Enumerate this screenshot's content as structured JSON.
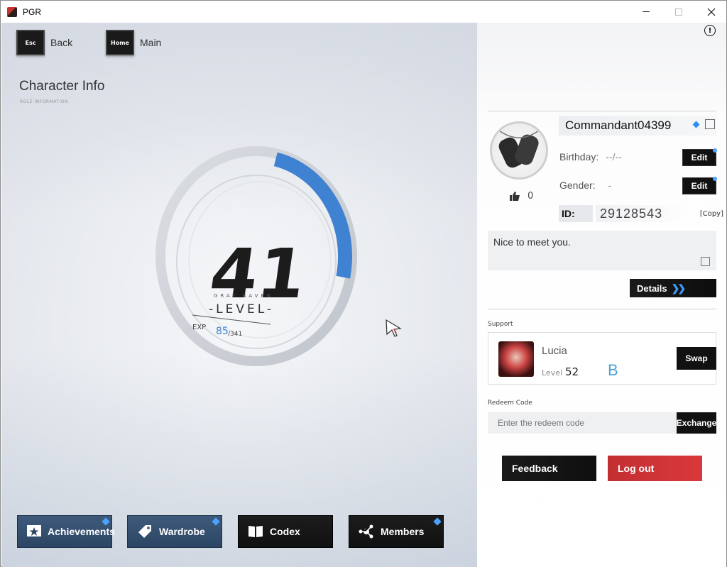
{
  "window": {
    "title": "PGR",
    "controls": [
      "minimize",
      "maximize",
      "close"
    ]
  },
  "nav": {
    "back_key": "Esc",
    "back_label": "Back",
    "home_key": "Home",
    "home_label": "Main"
  },
  "page": {
    "title": "Character Info",
    "subtitle": "ROLE INFORMATION"
  },
  "level": {
    "value": "41",
    "caption_small": "GRAY RAVEN",
    "caption": "-LEVEL-",
    "exp_label": "EXP",
    "exp_current": "85",
    "exp_max": "/341",
    "exp_fraction": 0.249
  },
  "bottom_buttons": {
    "achievements": "Achievements",
    "wardrobe": "Wardrobe",
    "codex": "Codex",
    "members": "Members"
  },
  "profile": {
    "name": "Commandant04399",
    "birthday_label": "Birthday:",
    "birthday_value": "--/--",
    "gender_label": "Gender:",
    "gender_value": "-",
    "edit_label": "Edit",
    "id_label": "ID:",
    "id_value": "29128543",
    "copy_label": "[Copy]",
    "likes": "0",
    "signature": "Nice to meet you.",
    "details_label": "Details"
  },
  "support": {
    "section_label": "Support",
    "character_name": "Lucia",
    "level_label": "Level",
    "level_value": "52",
    "rank": "B",
    "swap_label": "Swap"
  },
  "redeem": {
    "section_label": "Redeem Code",
    "placeholder": "Enter the redeem code",
    "exchange_label": "Exchange"
  },
  "actions": {
    "feedback": "Feedback",
    "logout": "Log out"
  },
  "colors": {
    "accent_blue": "#3f82d2",
    "logout_red": "#d33538",
    "button_dark": "#111111"
  }
}
